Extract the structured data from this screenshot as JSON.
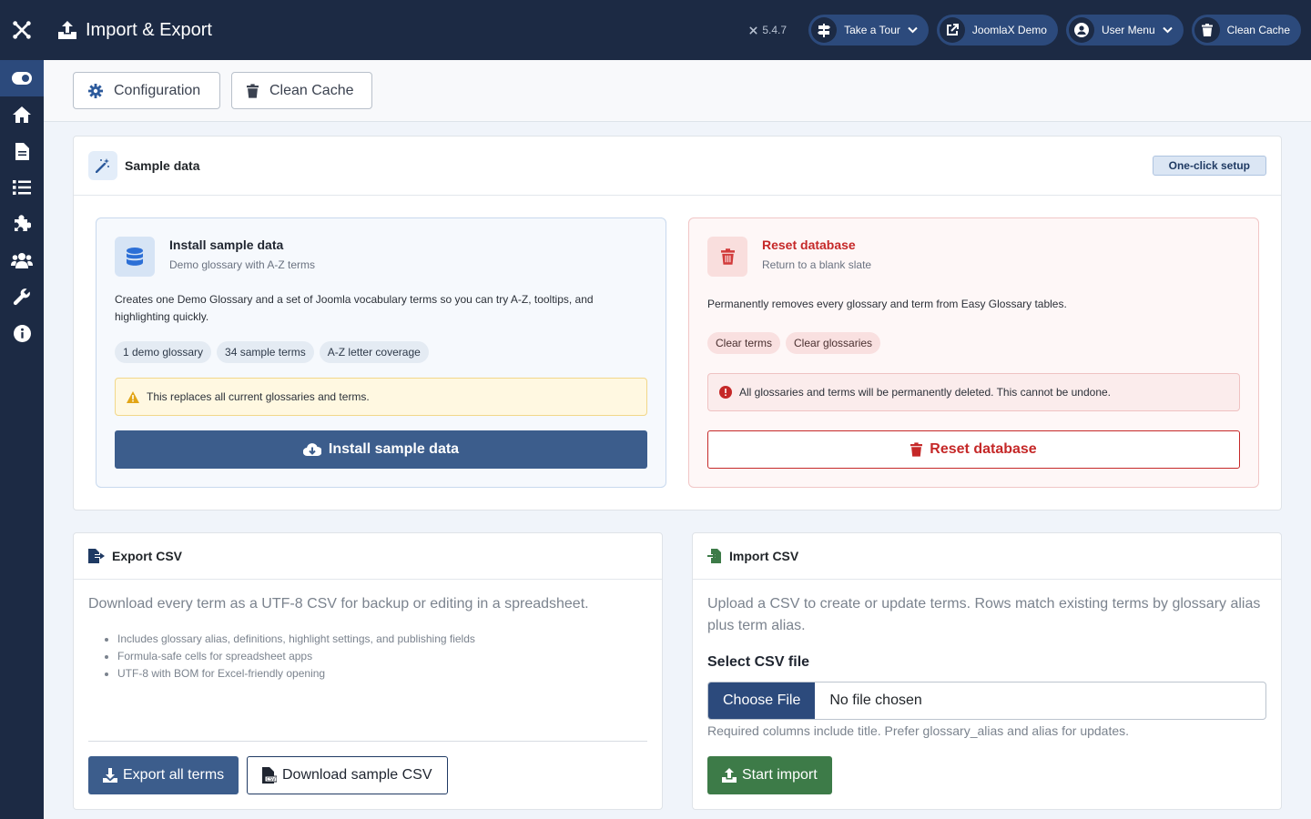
{
  "header": {
    "title": "Import & Export",
    "version": "5.4.7",
    "take_tour": "Take a Tour",
    "site_link": "JoomlaX Demo",
    "user_menu": "User Menu",
    "clean_cache": "Clean Cache"
  },
  "toolbar": {
    "configuration": "Configuration",
    "clean_cache": "Clean Cache"
  },
  "sample_data": {
    "title": "Sample data",
    "badge": "One-click setup",
    "install": {
      "title": "Install sample data",
      "subtitle": "Demo glossary with A-Z terms",
      "description": "Creates one Demo Glossary and a set of Joomla vocabulary terms so you can try A-Z, tooltips, and highlighting quickly.",
      "tags": [
        "1 demo glossary",
        "34 sample terms",
        "A-Z letter coverage"
      ],
      "warning": "This replaces all current glossaries and terms.",
      "button": "Install sample data"
    },
    "reset": {
      "title": "Reset database",
      "subtitle": "Return to a blank slate",
      "description": "Permanently removes every glossary and term from Easy Glossary tables.",
      "tags": [
        "Clear terms",
        "Clear glossaries"
      ],
      "danger": "All glossaries and terms will be permanently deleted. This cannot be undone.",
      "button": "Reset database"
    }
  },
  "export": {
    "title": "Export CSV",
    "lead": "Download every term as a UTF-8 CSV for backup or editing in a spreadsheet.",
    "bullets": [
      "Includes glossary alias, definitions, highlight settings, and publishing fields",
      "Formula-safe cells for spreadsheet apps",
      "UTF-8 with BOM for Excel-friendly opening"
    ],
    "export_button": "Export all terms",
    "sample_button": "Download sample CSV"
  },
  "import": {
    "title": "Import CSV",
    "lead": "Upload a CSV to create or update terms. Rows match existing terms by glossary alias plus term alias.",
    "file_label": "Select CSV file",
    "choose_file": "Choose File",
    "no_file": "No file chosen",
    "help": "Required columns include title. Prefer glossary_alias and alias for updates.",
    "start_button": "Start import"
  },
  "sidebar_icons": [
    "toggle-menu-icon",
    "home-icon",
    "file-icon",
    "list-icon",
    "puzzle-icon",
    "users-icon",
    "wrench-icon",
    "info-icon"
  ],
  "colors": {
    "header_bg": "#1c2a44",
    "primary": "#3c5d8c",
    "danger": "#c52828",
    "success": "#3d7b48"
  }
}
